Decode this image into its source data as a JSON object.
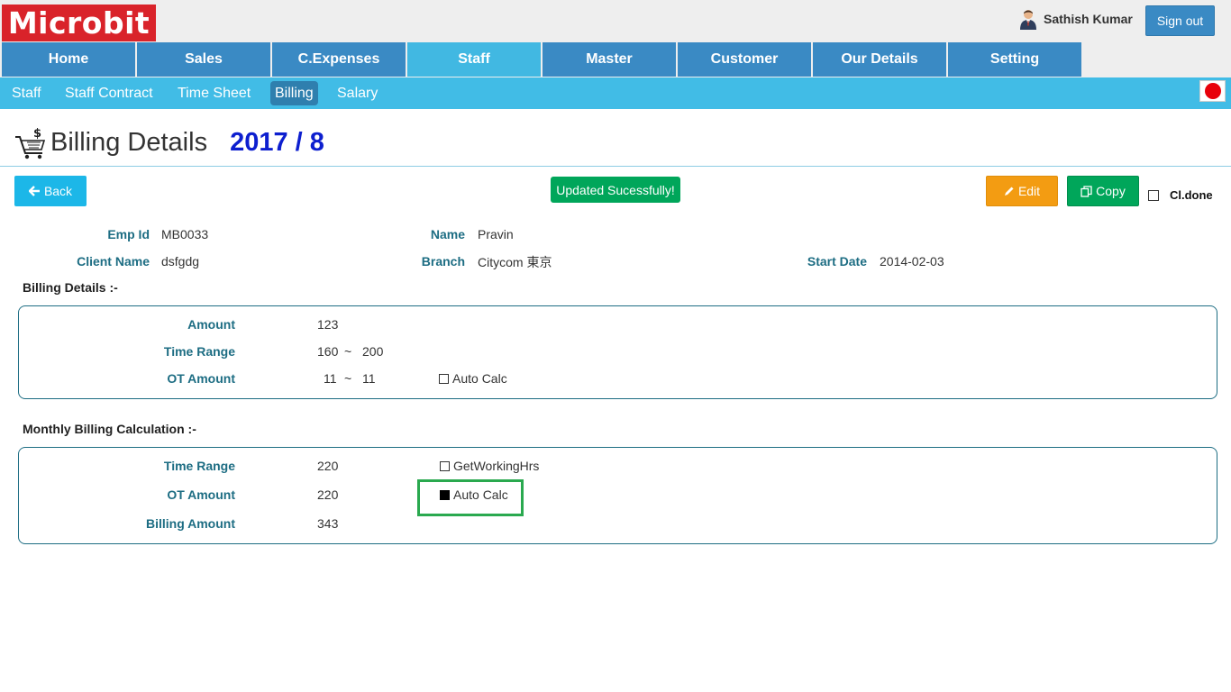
{
  "app": {
    "logo": "Microbit"
  },
  "user": {
    "name": "Sathish Kumar",
    "signout_label": "Sign out"
  },
  "main_nav": [
    "Home",
    "Sales",
    "C.Expenses",
    "Staff",
    "Master",
    "Customer",
    "Our Details",
    "Setting"
  ],
  "main_nav_active": "Staff",
  "sub_nav": [
    "Staff",
    "Staff Contract",
    "Time Sheet",
    "Billing",
    "Salary"
  ],
  "sub_nav_active": "Billing",
  "page": {
    "title": "Billing Details",
    "period": "2017 / 8"
  },
  "toolbar": {
    "back_label": "Back",
    "status_message": "Updated Sucessfully!",
    "edit_label": "Edit",
    "copy_label": "Copy",
    "cl_done_label": "Cl.done"
  },
  "employee": {
    "emp_id_label": "Emp Id",
    "emp_id": "MB0033",
    "name_label": "Name",
    "name": "Pravin",
    "client_label": "Client Name",
    "client": "dsfgdg",
    "branch_label": "Branch",
    "branch": "Citycom 東京",
    "start_label": "Start Date",
    "start_date": "2014-02-03"
  },
  "billing_details": {
    "title": "Billing Details :-",
    "amount_label": "Amount",
    "amount": "123",
    "time_range_label": "Time Range",
    "time_range_from": "160",
    "time_range_to": "200",
    "ot_amount_label": "OT Amount",
    "ot_from": "11",
    "ot_to": "11",
    "tilde": "~",
    "auto_calc_label": "Auto Calc",
    "auto_calc_checked": false
  },
  "monthly": {
    "title": "Monthly Billing Calculation :-",
    "time_range_label": "Time Range",
    "time_range": "220",
    "get_working_label": "GetWorkingHrs",
    "get_working_checked": false,
    "ot_amount_label": "OT Amount",
    "ot_amount": "220",
    "auto_calc_label": "Auto Calc",
    "auto_calc_checked": true,
    "billing_amount_label": "Billing Amount",
    "billing_amount": "343"
  },
  "colors": {
    "brand_red": "#d9232a",
    "nav_blue": "#3a8ac4",
    "subnav_blue": "#41bce6",
    "success_green": "#00a65a",
    "warning_orange": "#f39c12",
    "label_teal": "#1d6d83",
    "period_blue": "#0d1fcf",
    "highlight_green": "#2aa94f"
  }
}
